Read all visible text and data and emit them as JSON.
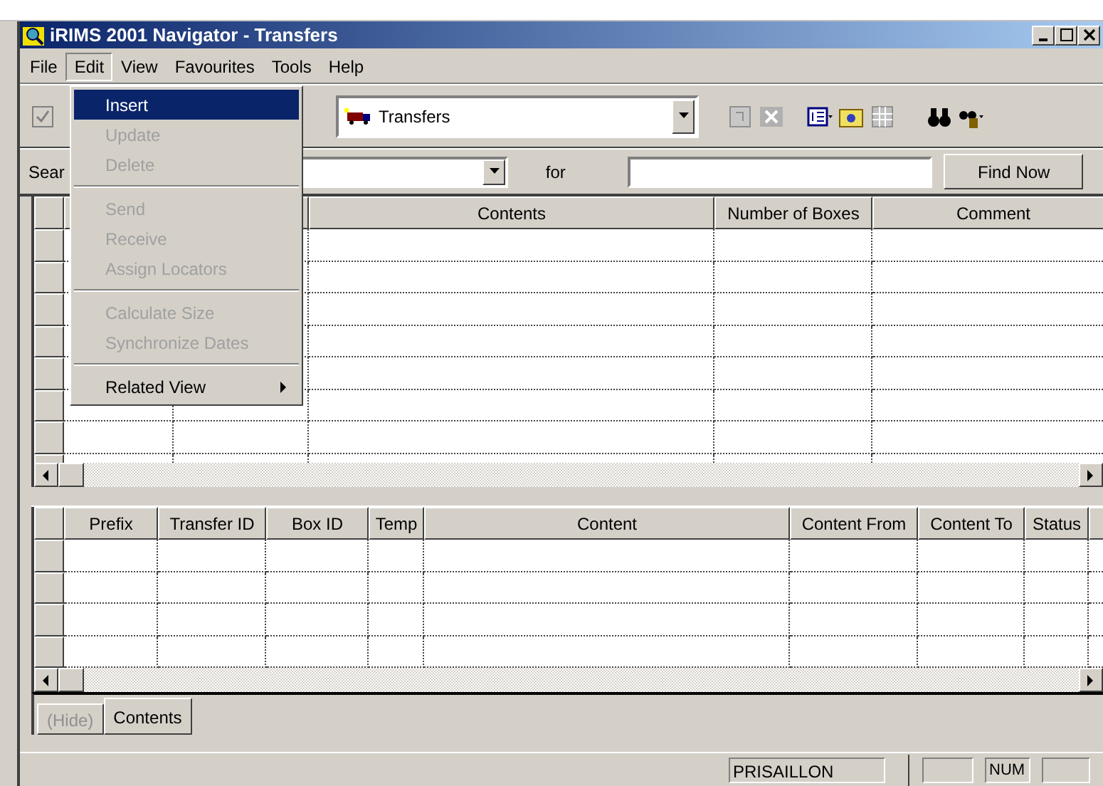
{
  "window": {
    "title": "iRIMS 2001 Navigator - Transfers"
  },
  "menu_bar": [
    {
      "label": "File",
      "selected": false
    },
    {
      "label": "Edit",
      "selected": true
    },
    {
      "label": "View",
      "selected": false
    },
    {
      "label": "Favourites",
      "selected": false
    },
    {
      "label": "Tools",
      "selected": false
    },
    {
      "label": "Help",
      "selected": false
    }
  ],
  "edit_menu": [
    {
      "kind": "item",
      "label": "Insert",
      "disabled": false,
      "selected": true,
      "submenu": false
    },
    {
      "kind": "item",
      "label": "Update",
      "disabled": true,
      "selected": false,
      "submenu": false
    },
    {
      "kind": "item",
      "label": "Delete",
      "disabled": true,
      "selected": false,
      "submenu": false
    },
    {
      "kind": "separator"
    },
    {
      "kind": "item",
      "label": "Send",
      "disabled": true,
      "selected": false,
      "submenu": false
    },
    {
      "kind": "item",
      "label": "Receive",
      "disabled": true,
      "selected": false,
      "submenu": false
    },
    {
      "kind": "item",
      "label": "Assign Locators",
      "disabled": true,
      "selected": false,
      "submenu": false
    },
    {
      "kind": "separator"
    },
    {
      "kind": "item",
      "label": "Calculate Size",
      "disabled": true,
      "selected": false,
      "submenu": false
    },
    {
      "kind": "item",
      "label": "Synchronize Dates",
      "disabled": true,
      "selected": false,
      "submenu": false
    },
    {
      "kind": "separator"
    },
    {
      "kind": "item",
      "label": "Related View",
      "disabled": false,
      "selected": false,
      "submenu": true
    }
  ],
  "toolbar": {
    "view_combo": "Transfers"
  },
  "search": {
    "label": "Sear",
    "for_label": "for",
    "button": "Find Now"
  },
  "upper_grid": {
    "columns": [
      "Contents",
      "Number of Boxes",
      "Comment"
    ]
  },
  "lower_grid": {
    "columns": [
      "Prefix",
      "Transfer ID",
      "Box ID",
      "Temp",
      "Content",
      "Content From",
      "Content To",
      "Status"
    ]
  },
  "tabs": [
    {
      "label": "(Hide)",
      "selected": false,
      "disabled": true
    },
    {
      "label": "Contents",
      "selected": true,
      "disabled": false
    }
  ],
  "status_bar": {
    "user": "PRISAILLON",
    "indicator": "NUM"
  }
}
